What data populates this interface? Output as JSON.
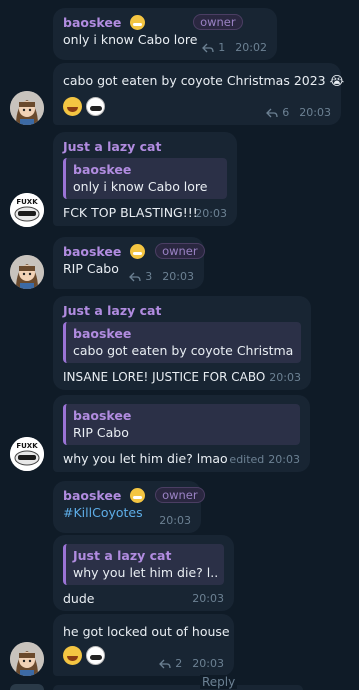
{
  "messages": [
    {
      "sender": "baoskee",
      "role": "owner",
      "text": "only i know Cabo lore",
      "replies": "1",
      "time": "20:02"
    },
    {
      "text": "cabo got eaten by coyote Christmas 2023 😭",
      "replies": "6",
      "time": "20:03"
    },
    {
      "sender": "Just a lazy cat",
      "quote_sender": "baoskee",
      "quote_text": "only i know Cabo lore",
      "text": "FCK TOP BLASTING!!!",
      "time": "20:03"
    },
    {
      "sender": "baoskee",
      "role": "owner",
      "text": "RIP Cabo",
      "replies": "3",
      "time": "20:03"
    },
    {
      "sender": "Just a lazy cat",
      "quote_sender": "baoskee",
      "quote_text": "cabo got eaten by coyote Christma...",
      "text": "INSANE LORE! JUSTICE FOR CABO",
      "time": "20:03"
    },
    {
      "quote_sender": "baoskee",
      "quote_text": "RIP Cabo",
      "text": "why you let him die? lmao",
      "edited": "edited",
      "time": "20:03"
    },
    {
      "sender": "baoskee",
      "role": "owner",
      "text": "#KillCoyotes",
      "time": "20:03"
    },
    {
      "quote_sender": "Just a lazy cat",
      "quote_text": "why you let him die? l...",
      "text": "dude",
      "time": "20:03"
    },
    {
      "text": "he got locked out of house",
      "replies": "2",
      "time": "20:03"
    }
  ],
  "footer": {
    "reply_label": "Reply"
  },
  "colors": {
    "background": "#0f1b27",
    "bubble": "#182533",
    "sender": "#b18ce0",
    "hashtag": "#5eaee8"
  }
}
